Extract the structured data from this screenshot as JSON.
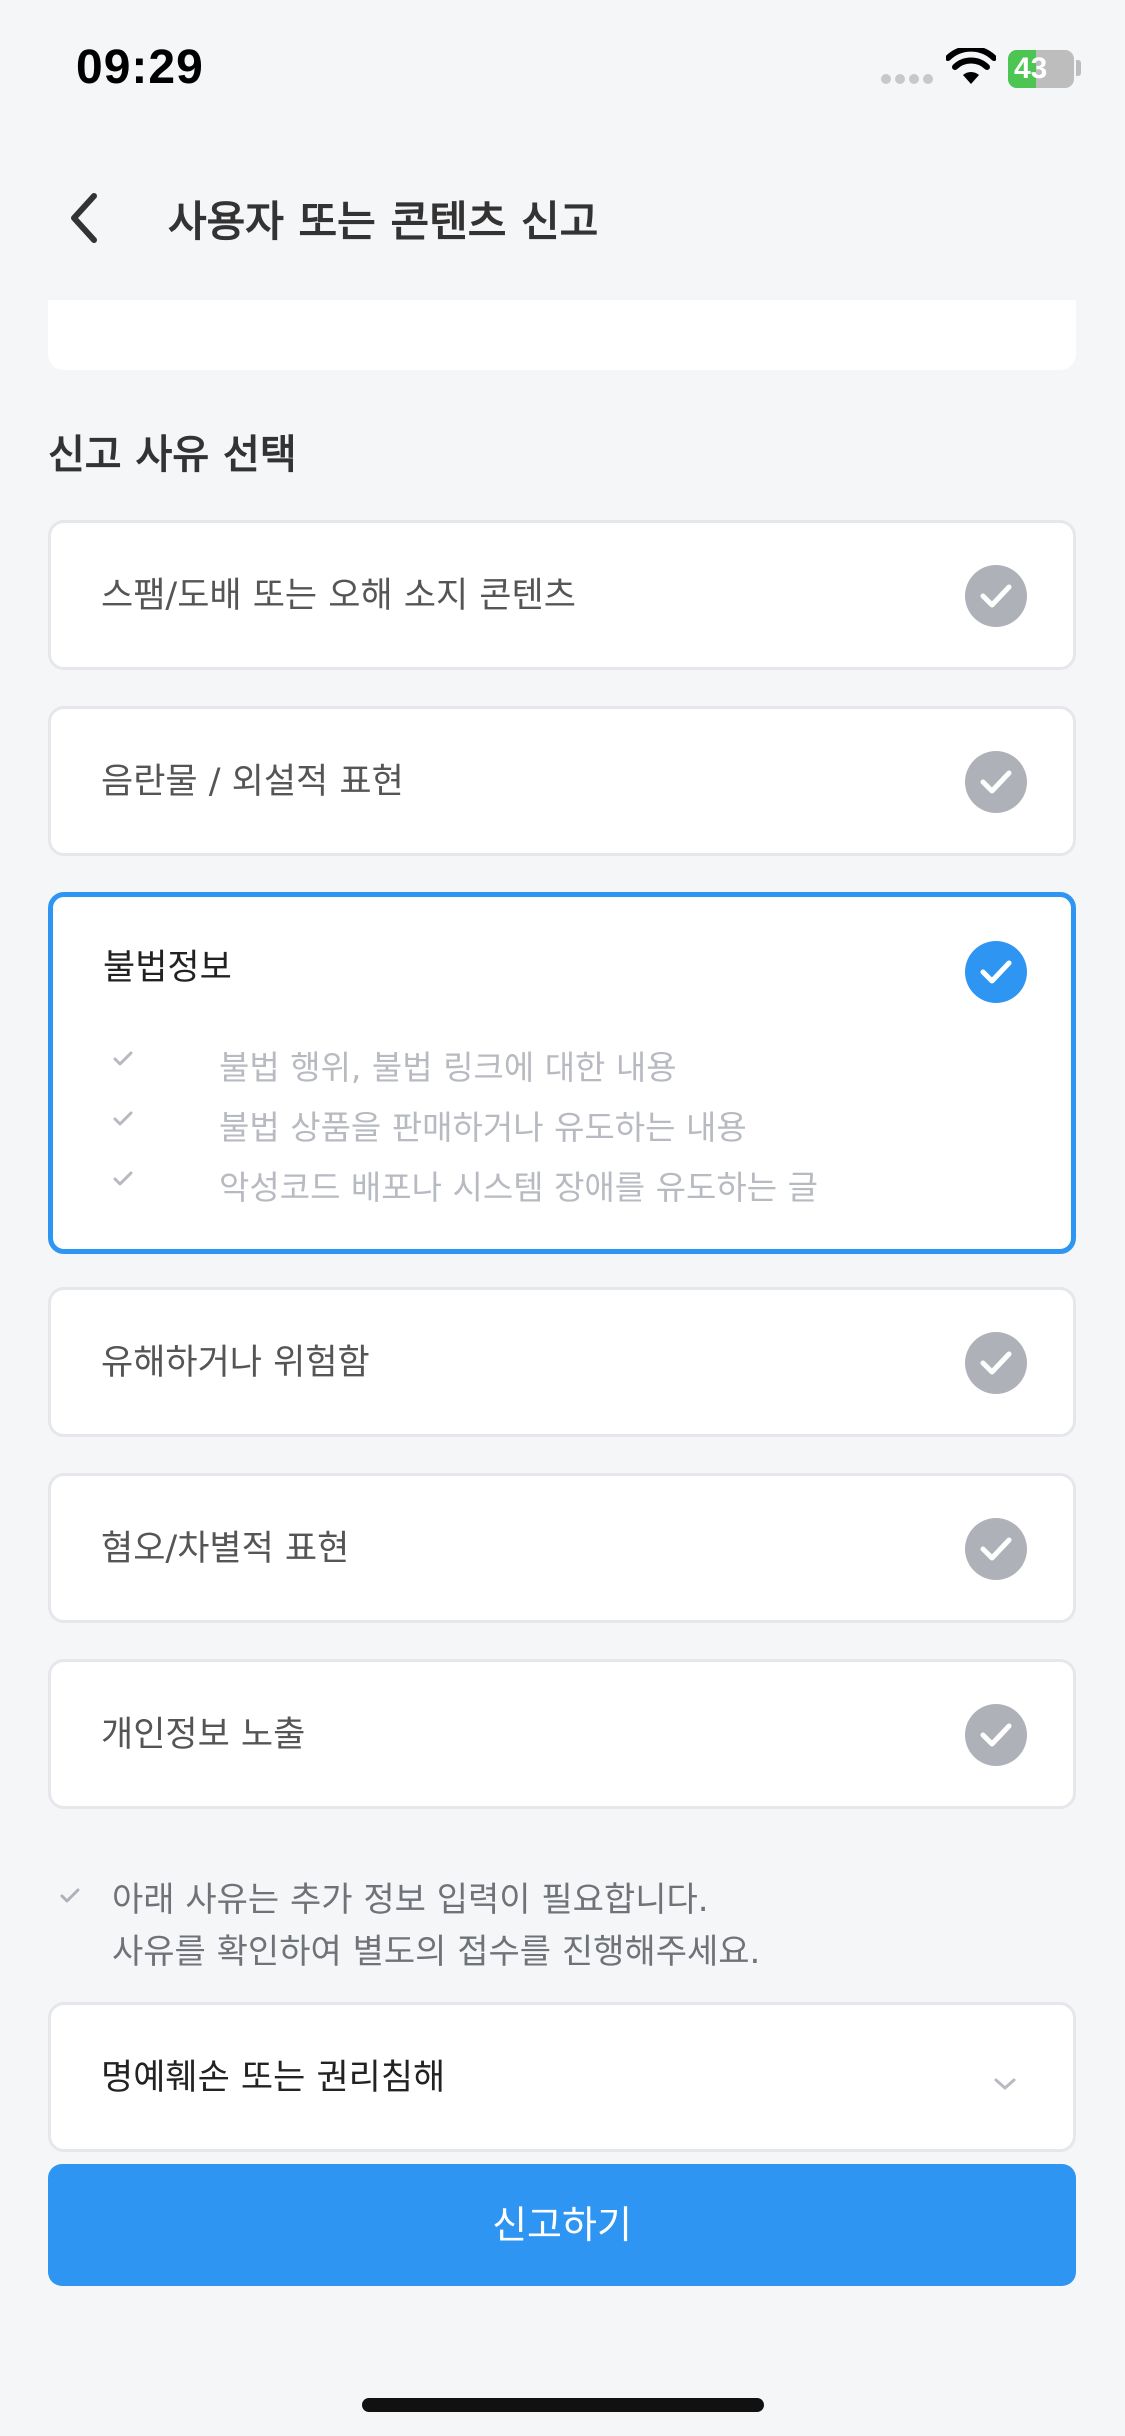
{
  "status_bar": {
    "time": "09:29",
    "battery_label": "43",
    "battery_level": 0.43,
    "battery_color": "#4cc552"
  },
  "header": {
    "title": "사용자 또는 콘텐츠 신고",
    "back_icon": "chevron-left-icon"
  },
  "section": {
    "title": "신고 사유 선택"
  },
  "options": [
    {
      "label": "스팸/도배 또는 오해 소지 콘텐츠",
      "selected": false
    },
    {
      "label": "음란물 / 외설적 표현",
      "selected": false
    },
    {
      "label": "불법정보",
      "selected": true,
      "details": [
        "불법 행위, 불법 링크에 대한 내용",
        "불법 상품을 판매하거나 유도하는 내용",
        "악성코드 배포나 시스템 장애를 유도하는 글"
      ]
    },
    {
      "label": "유해하거나 위험함",
      "selected": false
    },
    {
      "label": "혐오/차별적 표현",
      "selected": false
    },
    {
      "label": "개인정보 노출",
      "selected": false
    }
  ],
  "note": {
    "line1": "아래 사유는 추가 정보 입력이 필요합니다.",
    "line2": "사유를 확인하여 별도의 접수를 진행해주세요."
  },
  "dropdown": {
    "label": "명예훼손 또는 권리침해"
  },
  "submit": {
    "label": "신고하기"
  },
  "colors": {
    "accent": "#2e96f2",
    "check_inactive": "#aeb1b8",
    "background": "#f5f6f8"
  }
}
